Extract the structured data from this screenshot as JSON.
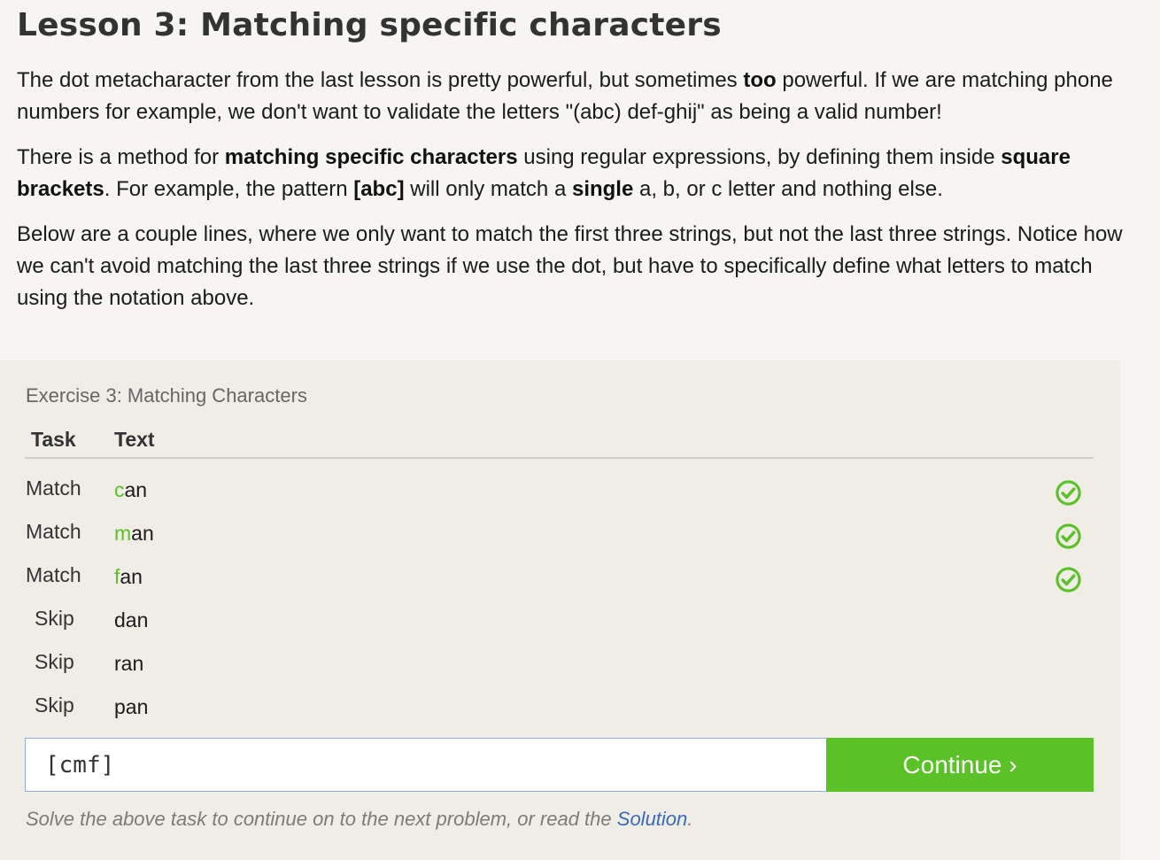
{
  "lesson": {
    "title": "Lesson 3: Matching specific characters",
    "p1": {
      "a": "The dot metacharacter from the last lesson is pretty powerful, but sometimes ",
      "b": "too",
      "c": " powerful. If we are matching phone numbers for example, we don't want to validate the letters \"(abc) def-ghij\" as being a valid number!"
    },
    "p2": {
      "a": "There is a method for ",
      "b": "matching specific characters",
      "c": " using regular expressions, by defining them inside ",
      "d": "square brackets",
      "e": ". For example, the pattern ",
      "f": "[abc]",
      "g": " will only match a ",
      "h": "single",
      "i": " a, b, or c letter and nothing else."
    },
    "p3": "Below are a couple lines, where we only want to match the first three strings, but not the last three strings. Notice how we can't avoid matching the last three strings if we use the dot, but have to specifically define what letters to match using the notation above."
  },
  "exercise": {
    "title": "Exercise 3: Matching Characters",
    "headers": {
      "task": "Task",
      "text": "Text"
    },
    "rows": [
      {
        "task": "Match",
        "hl": "c",
        "rest": "an",
        "status": "check-circle-icon"
      },
      {
        "task": "Match",
        "hl": "m",
        "rest": "an",
        "status": "check-circle-icon"
      },
      {
        "task": "Match",
        "hl": "f",
        "rest": "an",
        "status": "check-circle-icon"
      },
      {
        "task": "Skip",
        "hl": "",
        "rest": "dan",
        "status": ""
      },
      {
        "task": "Skip",
        "hl": "",
        "rest": "ran",
        "status": ""
      },
      {
        "task": "Skip",
        "hl": "",
        "rest": "pan",
        "status": ""
      }
    ],
    "answer_value": "[cmf]",
    "continue_label": "Continue ›",
    "hint_prefix": "Solve the above task to continue on to the next problem, or read the ",
    "hint_link": "Solution",
    "hint_suffix": ".",
    "colors": {
      "accent": "#5ac126",
      "highlight": "#5ac026",
      "link": "#3a69bd"
    }
  }
}
